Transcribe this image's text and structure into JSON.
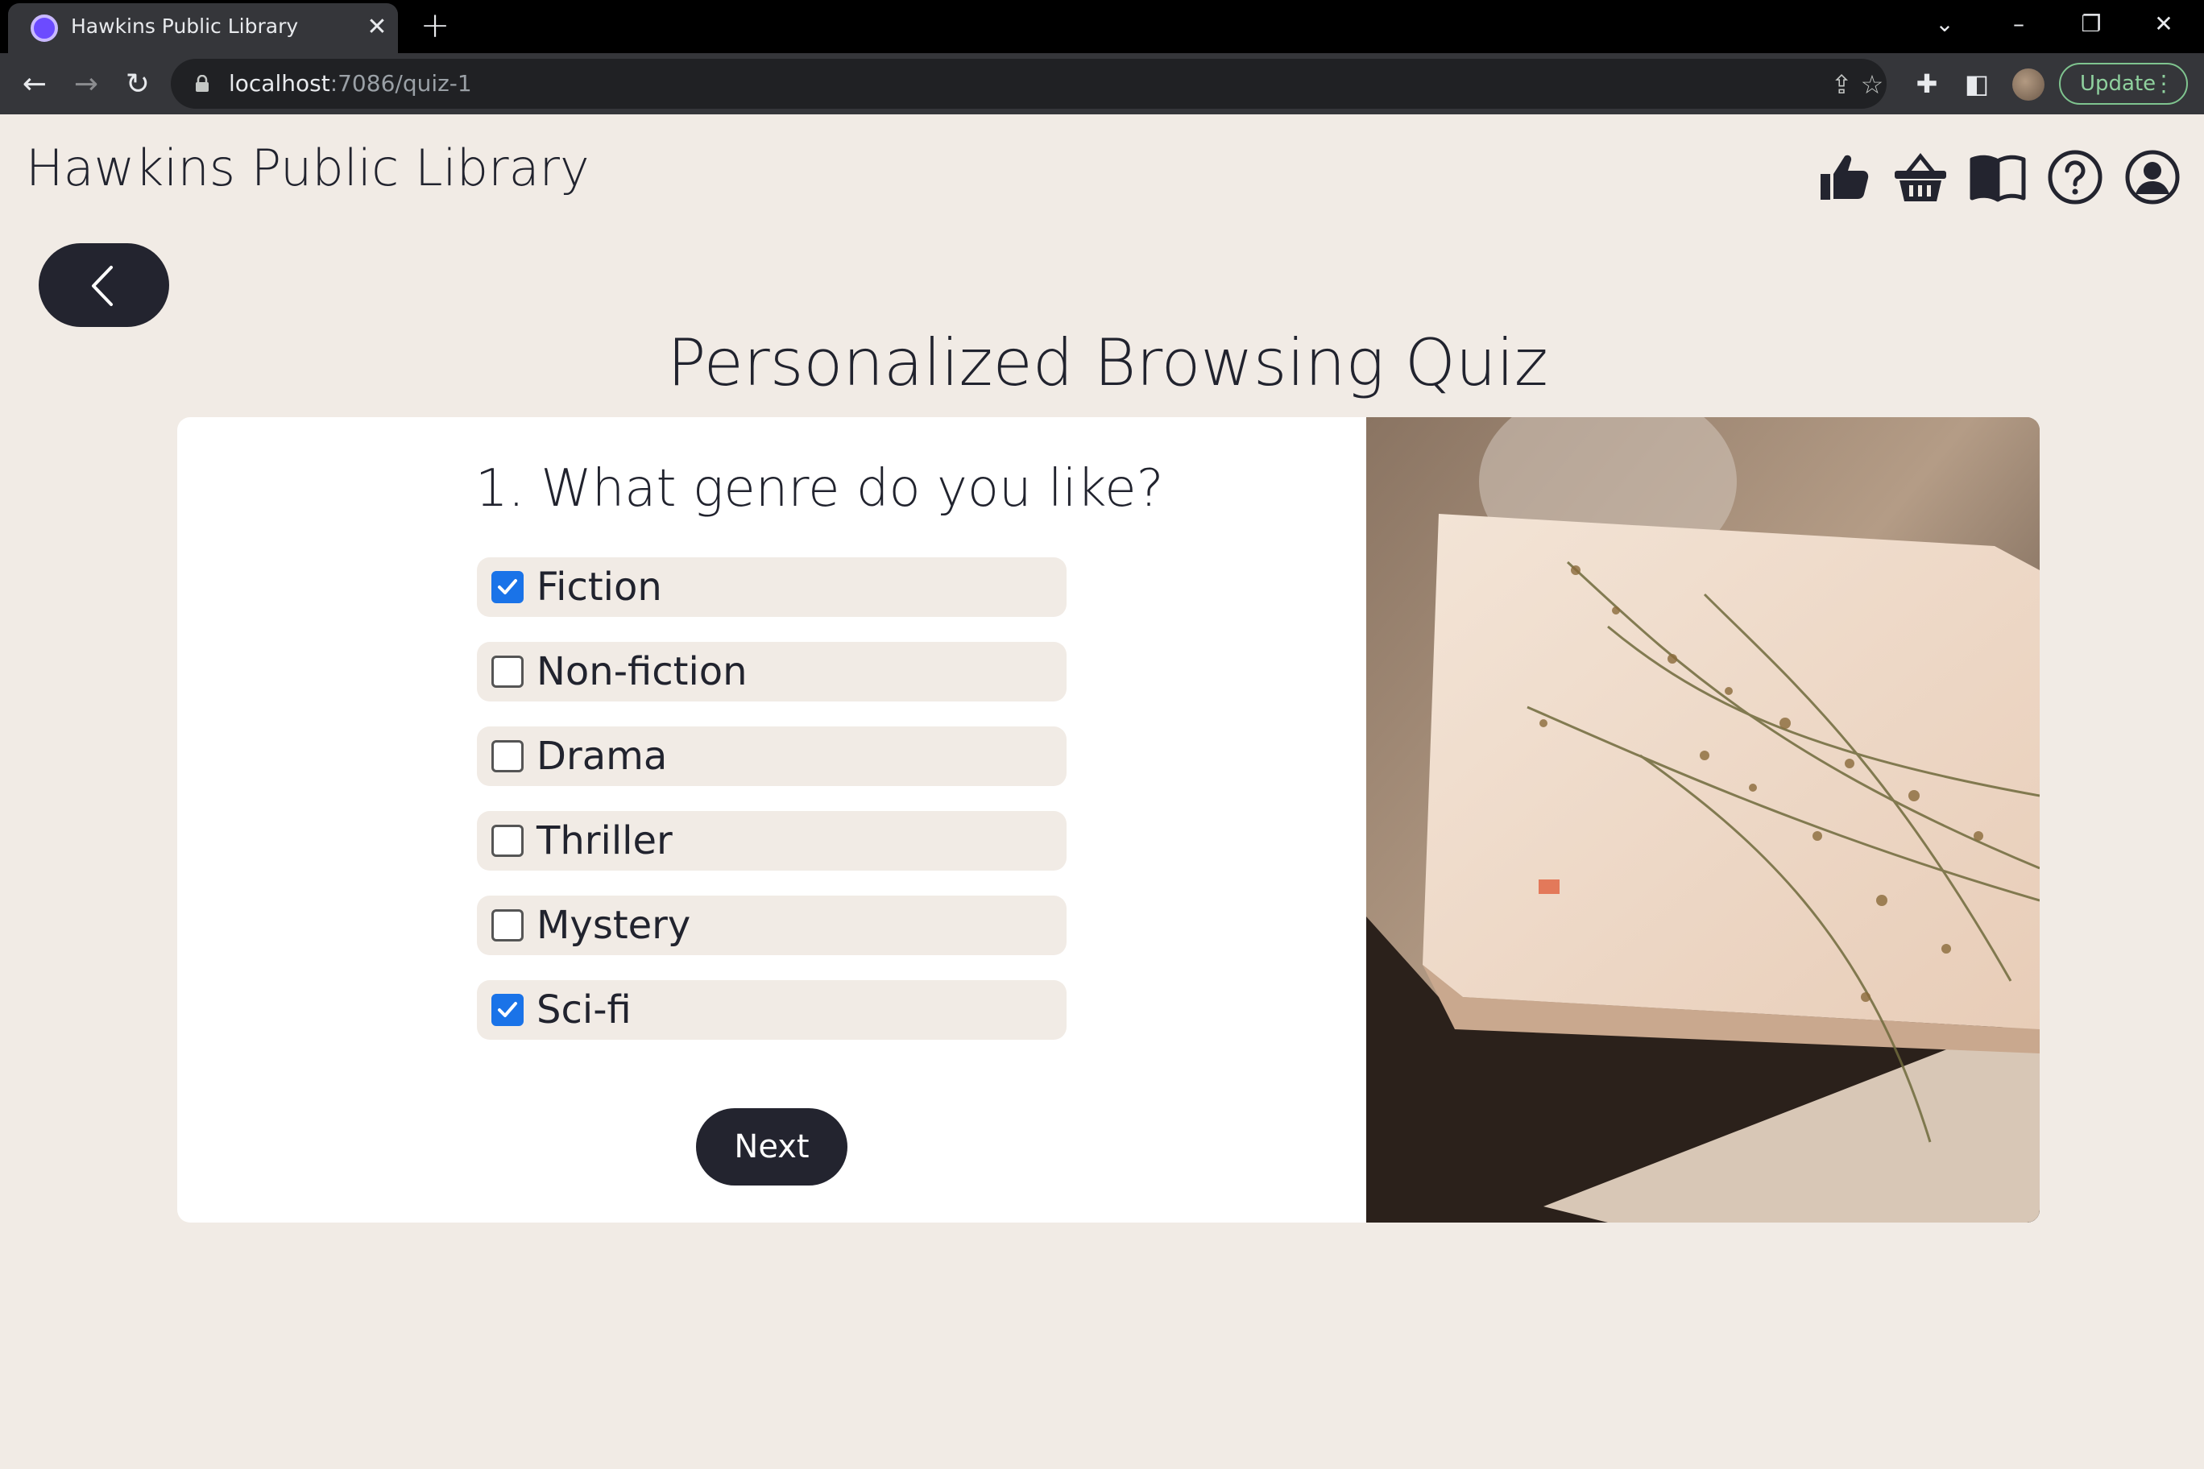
{
  "browser": {
    "tab_title": "Hawkins Public Library",
    "url_host": "localhost",
    "url_path": ":7086/quiz-1",
    "update_label": "Update"
  },
  "site": {
    "title": "Hawkins Public Library",
    "header_icons": [
      "thumbs-up-icon",
      "basket-icon",
      "book-icon",
      "help-icon",
      "account-icon"
    ]
  },
  "quiz": {
    "title": "Personalized Browsing Quiz",
    "question": "1. What genre do you like?",
    "options": [
      {
        "label": "Fiction",
        "checked": true
      },
      {
        "label": "Non-fiction",
        "checked": false
      },
      {
        "label": "Drama",
        "checked": false
      },
      {
        "label": "Thriller",
        "checked": false
      },
      {
        "label": "Mystery",
        "checked": false
      },
      {
        "label": "Sci-fi",
        "checked": true
      }
    ],
    "next_label": "Next"
  },
  "colors": {
    "page_bg": "#f1ebe5",
    "dark_button": "#23242f",
    "checkbox_checked": "#1a73e8"
  }
}
